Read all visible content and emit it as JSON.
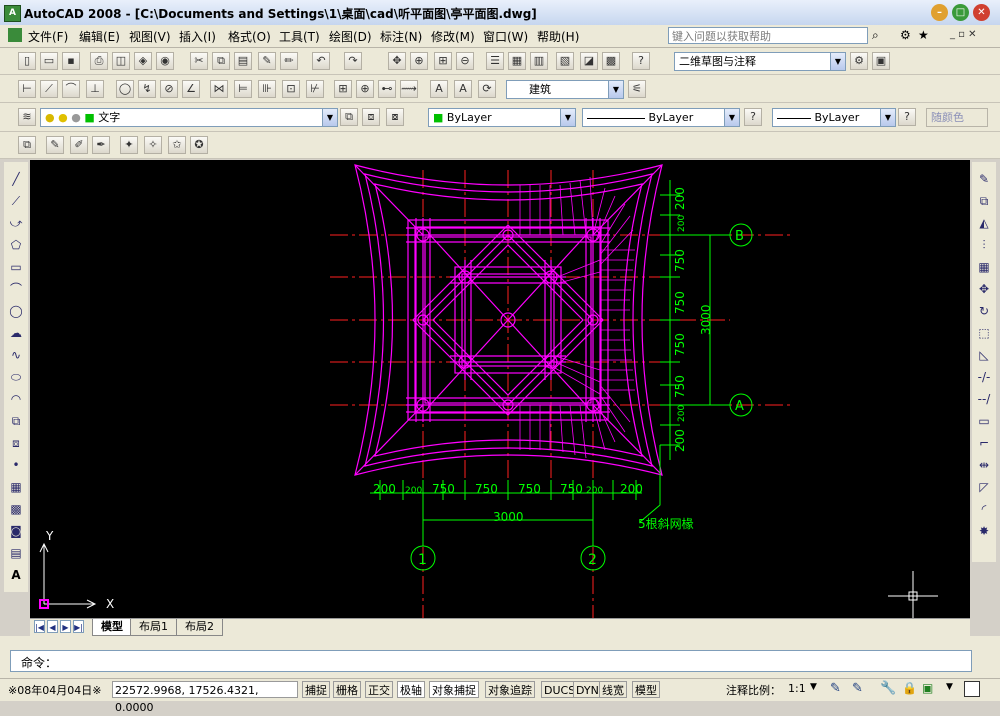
{
  "window": {
    "title": "AutoCAD 2008 - [C:\\Documents and Settings\\1\\桌面\\cad\\听平面图\\亭平面图.dwg]",
    "app_icon": "A"
  },
  "menu": {
    "items": [
      "文件(F)",
      "编辑(E)",
      "视图(V)",
      "插入(I)",
      "格式(O)",
      "工具(T)",
      "绘图(D)",
      "标注(N)",
      "修改(M)",
      "窗口(W)",
      "帮助(H)"
    ],
    "search_placeholder": "键入问题以获取帮助"
  },
  "toolbars": {
    "workspace": "二维草图与注释",
    "text_style": "建筑",
    "layer": "文字",
    "color": "ByLayer",
    "linetype": "ByLayer",
    "lineweight": "ByLayer",
    "plotstyle": "随颜色"
  },
  "drawing": {
    "dims_bottom": [
      "200",
      "200",
      "750",
      "750",
      "750",
      "750",
      "200",
      "200"
    ],
    "dim_total_bottom": "3000",
    "dims_right": [
      "200",
      "200",
      "750",
      "750",
      "750",
      "750",
      "200",
      "200"
    ],
    "dim_total_right": "3000",
    "grid_labels": {
      "top_right": "B",
      "bottom_right": "A",
      "bottom_left": "1",
      "bottom_right_axis": "2"
    },
    "note": "5根斜网椽",
    "ucs_x": "X",
    "ucs_y": "Y",
    "colors": {
      "structure": "#ff00ff",
      "dims": "#00ff00",
      "axes": "#ff0000",
      "background": "#000000"
    }
  },
  "tabs": [
    "模型",
    "布局1",
    "布局2"
  ],
  "command": {
    "prompt": "命令："
  },
  "status": {
    "date": "※08年04月04日※",
    "coords": "22572.9968, 17526.4321, 0.0000",
    "toggles": [
      "捕捉",
      "栅格",
      "正交",
      "极轴",
      "对象捕捉",
      "对象追踪",
      "DUCS",
      "DYN",
      "线宽",
      "模型"
    ],
    "annotation_scale_label": "注释比例：",
    "annotation_scale": "1:1"
  }
}
